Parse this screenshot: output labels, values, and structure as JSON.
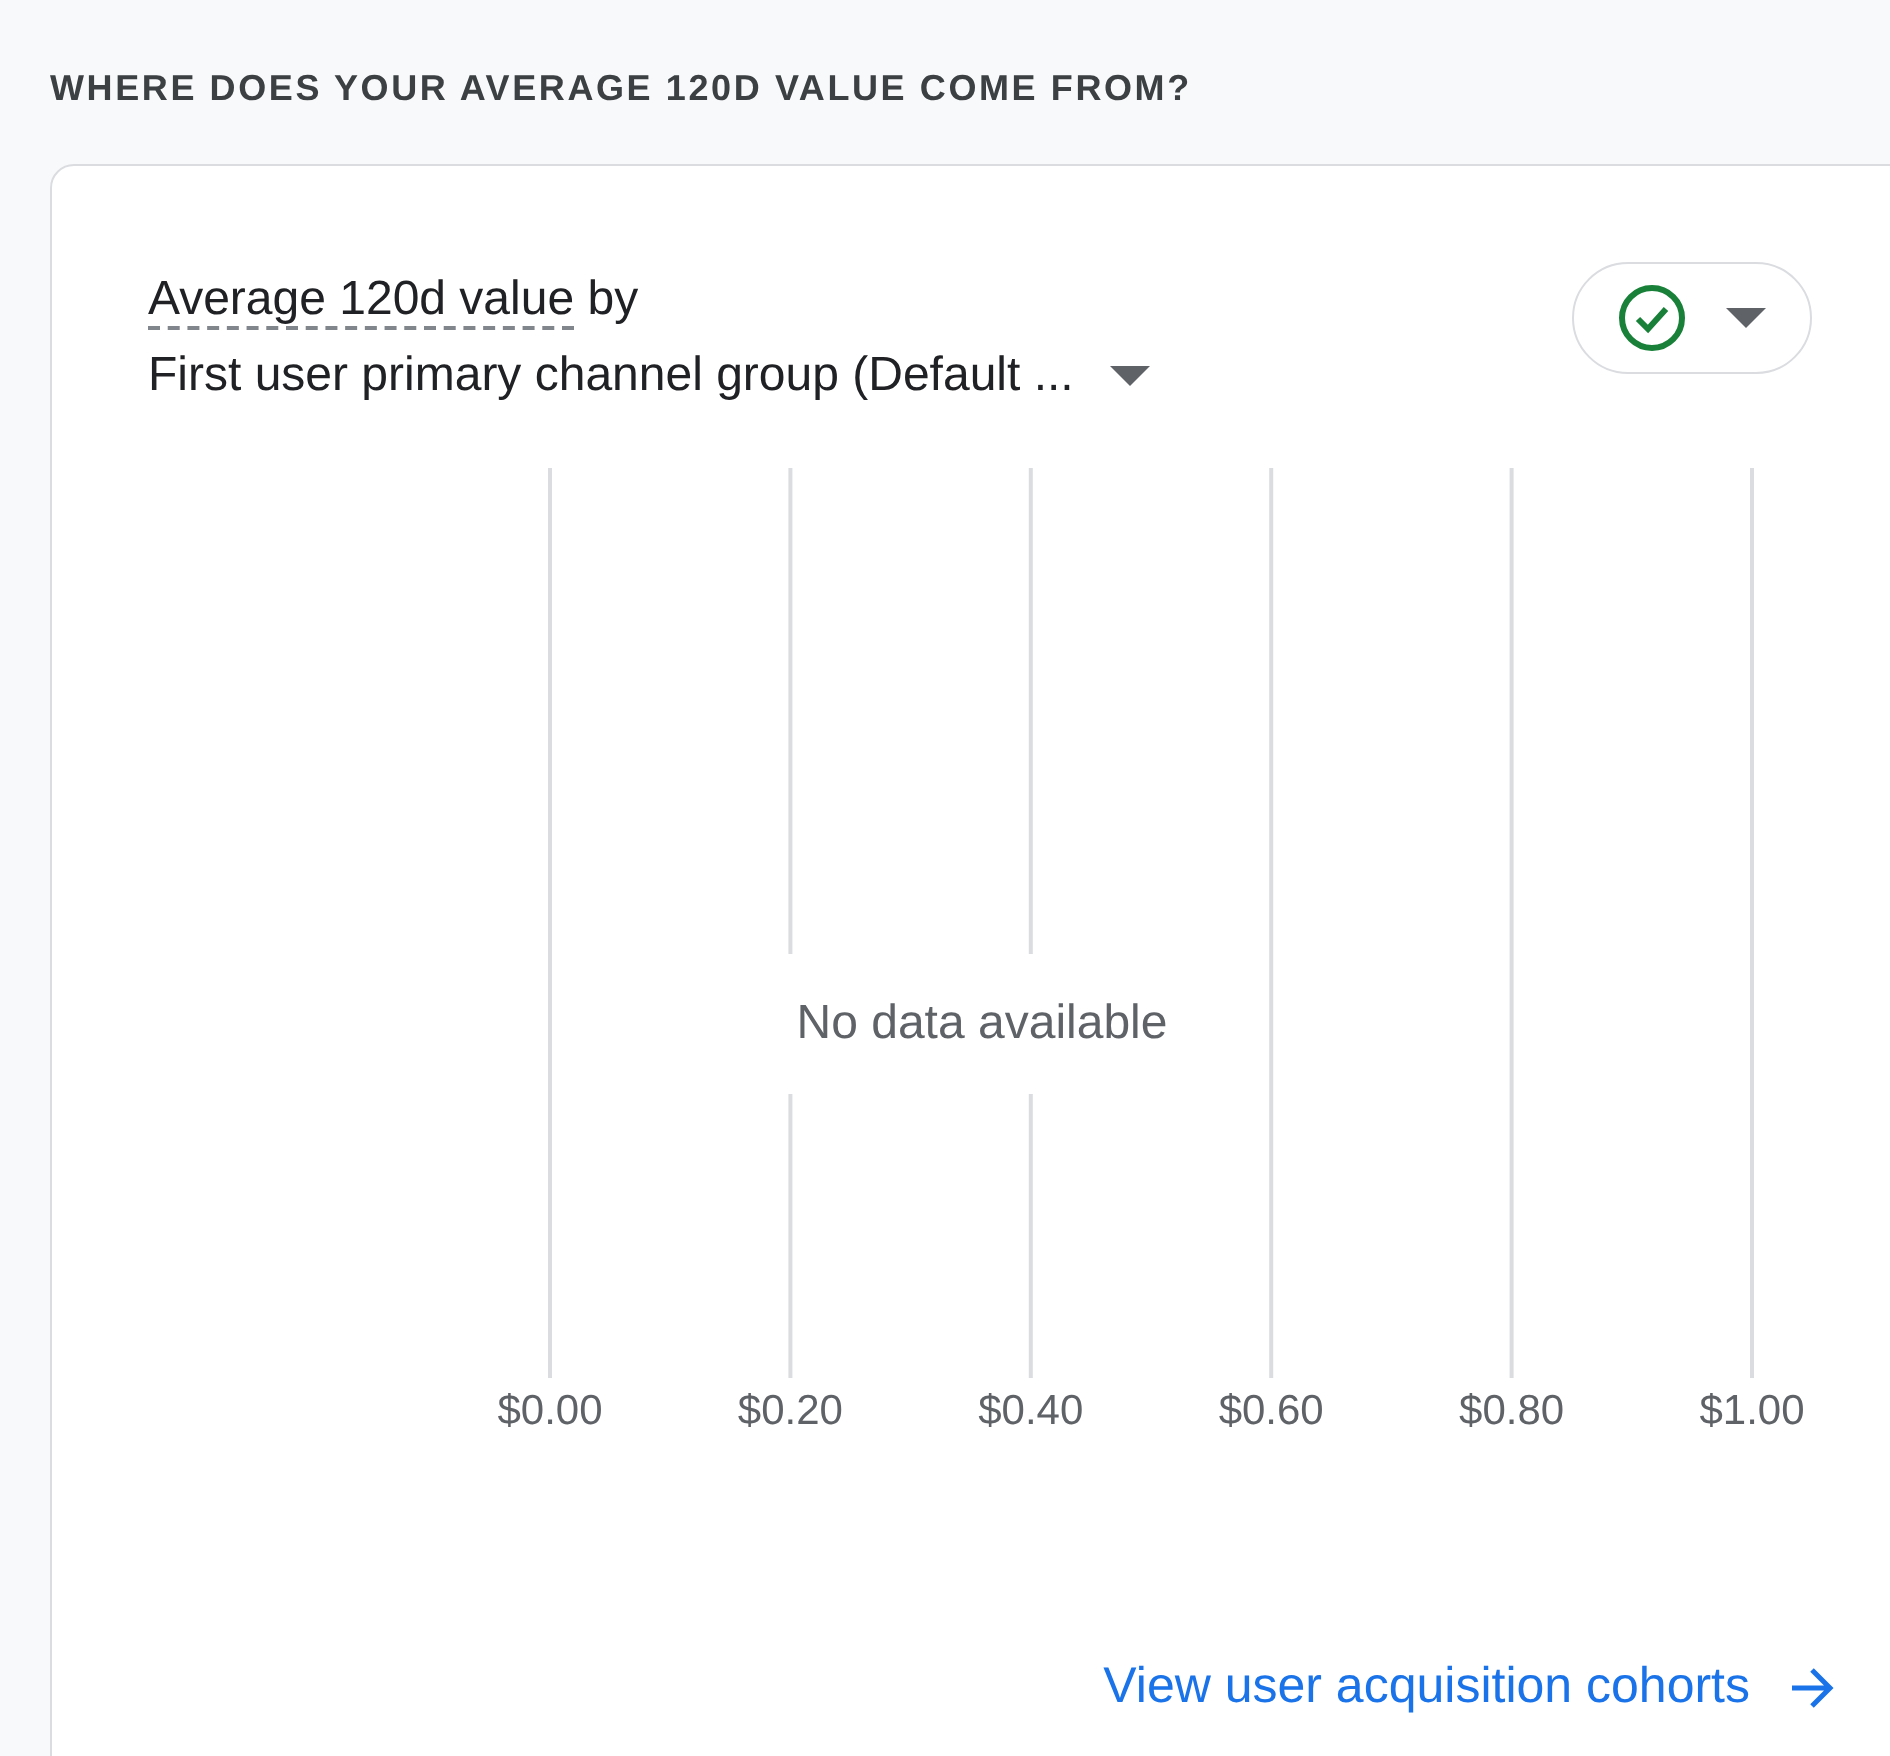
{
  "section_heading": "WHERE DOES YOUR AVERAGE 120D VALUE COME FROM?",
  "card": {
    "title": {
      "metric": "Average 120d value",
      "joiner": "by",
      "dimension": "First user primary channel group (Default ..."
    },
    "status_button": {
      "ok": true
    },
    "chart_data": {
      "type": "bar",
      "orientation": "horizontal",
      "categories": [
        null
      ],
      "values": [
        null
      ],
      "grid": true,
      "xlim": [
        0,
        1
      ],
      "xticks": [
        {
          "value": 0,
          "label": "$0.00"
        },
        {
          "value": 0.2,
          "label": "$0.20"
        },
        {
          "value": 0.4,
          "label": "$0.40"
        },
        {
          "value": 0.6,
          "label": "$0.60"
        },
        {
          "value": 0.8,
          "label": "$0.80"
        },
        {
          "value": 1,
          "label": "$1.00"
        }
      ]
    },
    "empty_message": "No data available",
    "link": "View user acquisition cohorts"
  }
}
